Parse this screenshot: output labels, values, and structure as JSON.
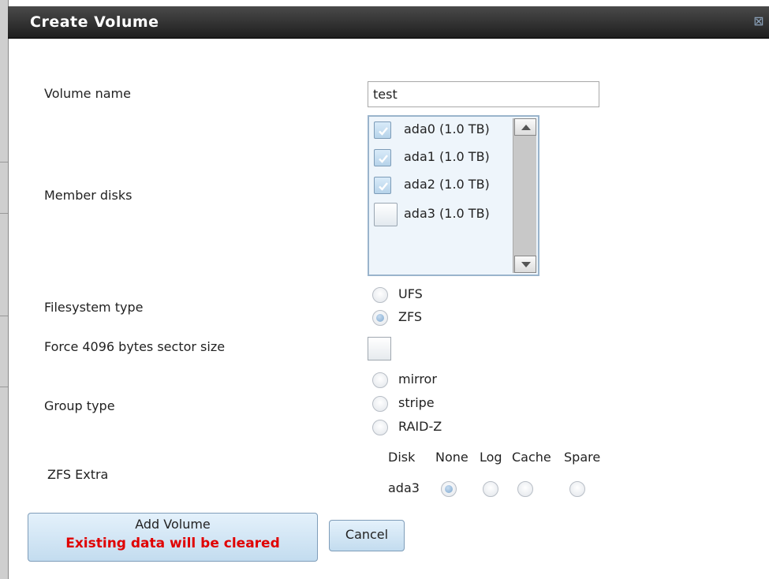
{
  "dialog": {
    "title": "Create Volume",
    "close_icon": "close-icon"
  },
  "volume_name": {
    "label": "Volume name",
    "value": "test"
  },
  "member_disks": {
    "label": "Member disks",
    "disks": [
      {
        "label": "ada0 (1.0 TB)",
        "checked": true
      },
      {
        "label": "ada1 (1.0 TB)",
        "checked": true
      },
      {
        "label": "ada2 (1.0 TB)",
        "checked": true
      },
      {
        "label": "ada3 (1.0 TB)",
        "checked": false
      }
    ]
  },
  "filesystem_type": {
    "label": "Filesystem type",
    "options": [
      "UFS",
      "ZFS"
    ],
    "selected": "ZFS"
  },
  "force_4096": {
    "label": "Force 4096 bytes sector size",
    "checked": false
  },
  "group_type": {
    "label": "Group type",
    "options": [
      "mirror",
      "stripe",
      "RAID-Z"
    ],
    "selected": null
  },
  "zfs_extra": {
    "label": "ZFS Extra",
    "headers": [
      "Disk",
      "None",
      "Log",
      "Cache",
      "Spare"
    ],
    "rows": [
      {
        "disk": "ada3",
        "selected": "None"
      }
    ]
  },
  "buttons": {
    "add_volume": "Add Volume",
    "add_volume_warning": "Existing data will be cleared",
    "cancel": "Cancel"
  },
  "colors": {
    "warning": "#e00000",
    "titlebar": "#2a2a2a",
    "accent": "#7f9db9"
  }
}
